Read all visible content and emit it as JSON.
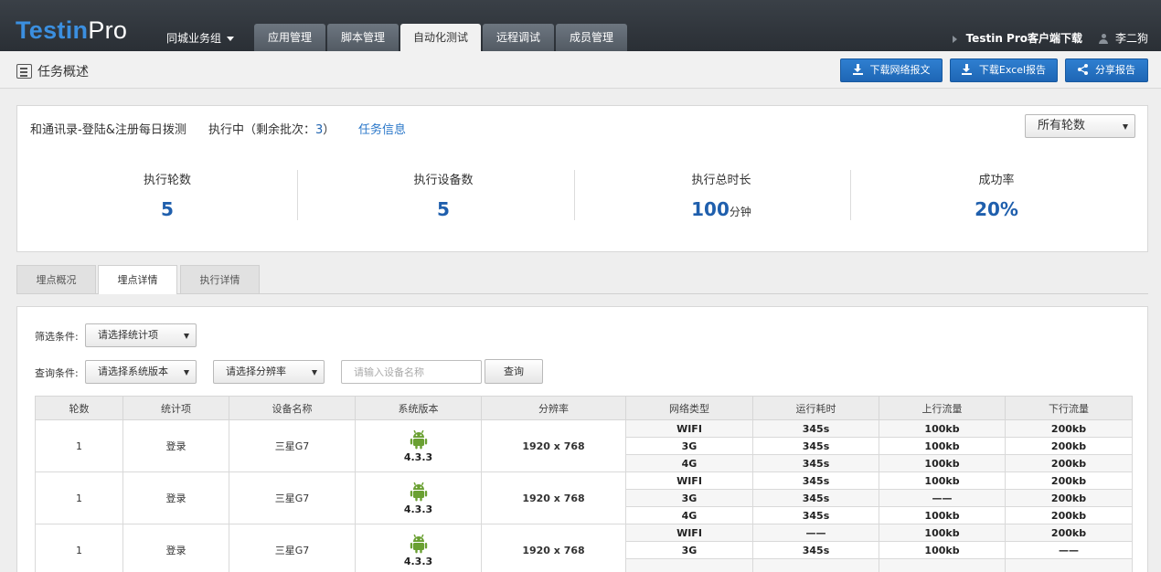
{
  "header": {
    "logo_a": "Testin",
    "logo_b": "Pro",
    "group": "同城业务组",
    "tabs": [
      {
        "label": "应用管理",
        "active": false
      },
      {
        "label": "脚本管理",
        "active": false
      },
      {
        "label": "自动化测试",
        "active": true
      },
      {
        "label": "远程调试",
        "active": false
      },
      {
        "label": "成员管理",
        "active": false
      }
    ],
    "client_download": "Testin Pro客户端下载",
    "user_name": "李二狗"
  },
  "subbar": {
    "title": "任务概述",
    "btn_network": "下载网络报文",
    "btn_excel": "下载Excel报告",
    "btn_share": "分享报告"
  },
  "summary": {
    "task_name": "和通讯录-登陆&注册每日拨测",
    "status_prefix": "执行中（剩余批次：",
    "remaining": "3",
    "status_suffix": "）",
    "task_info": "任务信息",
    "round_select": "所有轮数",
    "stats": [
      {
        "label": "执行轮数",
        "value": "5",
        "unit": ""
      },
      {
        "label": "执行设备数",
        "value": "5",
        "unit": ""
      },
      {
        "label": "执行总时长",
        "value": "100",
        "unit": "分钟"
      },
      {
        "label": "成功率",
        "value": "20%",
        "unit": ""
      }
    ]
  },
  "detail_tabs": [
    {
      "label": "埋点概况",
      "active": false
    },
    {
      "label": "埋点详情",
      "active": true
    },
    {
      "label": "执行详情",
      "active": false
    }
  ],
  "filters": {
    "filter_label": "筛选条件:",
    "stat_select": "请选择统计项",
    "query_label": "查询条件:",
    "version_select": "请选择系统版本",
    "resolution_select": "请选择分辨率",
    "device_placeholder": "请输入设备名称",
    "query_button": "查询"
  },
  "table": {
    "headers": [
      "轮数",
      "统计项",
      "设备名称",
      "系统版本",
      "分辨率",
      "网络类型",
      "运行耗时",
      "上行流量",
      "下行流量"
    ],
    "groups": [
      {
        "round": "1",
        "item": "登录",
        "device": "三星G7",
        "version": "4.3.3",
        "resolution": "1920 x 768",
        "rows": [
          {
            "network": "WIFI",
            "time": "345s",
            "up": "100kb",
            "down": "200kb"
          },
          {
            "network": "3G",
            "time": "345s",
            "up": "100kb",
            "down": "200kb"
          },
          {
            "network": "4G",
            "time": "345s",
            "up": "100kb",
            "down": "200kb"
          }
        ]
      },
      {
        "round": "1",
        "item": "登录",
        "device": "三星G7",
        "version": "4.3.3",
        "resolution": "1920 x 768",
        "rows": [
          {
            "network": "WIFI",
            "time": "345s",
            "up": "100kb",
            "down": "200kb"
          },
          {
            "network": "3G",
            "time": "345s",
            "up": "——",
            "down": "200kb"
          },
          {
            "network": "4G",
            "time": "345s",
            "up": "100kb",
            "down": "200kb"
          }
        ]
      },
      {
        "round": "1",
        "item": "登录",
        "device": "三星G7",
        "version": "4.3.3",
        "resolution": "1920 x 768",
        "rows": [
          {
            "network": "WIFI",
            "time": "——",
            "up": "100kb",
            "down": "200kb"
          },
          {
            "network": "3G",
            "time": "345s",
            "up": "100kb",
            "down": "——"
          },
          {
            "network": "",
            "time": "",
            "up": "",
            "down": ""
          }
        ]
      }
    ]
  },
  "colors": {
    "accent": "#1f5fad",
    "link": "#2a77c9",
    "topbar": "#32383e",
    "android": "#6aa032"
  }
}
